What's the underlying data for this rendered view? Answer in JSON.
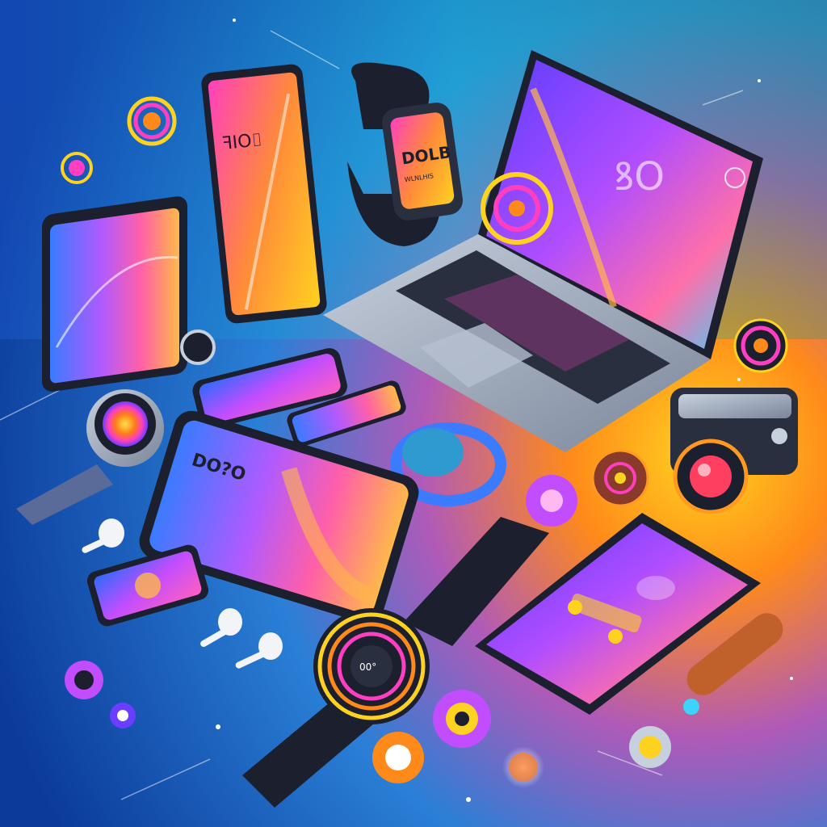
{
  "scene": {
    "palette": {
      "bg_top_left": "#1a5fd0",
      "bg_mid": "#17b6d8",
      "bg_right": "#ff7a18",
      "bg_bottom_left": "#0b3a9a",
      "accent_pink": "#ff3fbf",
      "accent_orange": "#ff9a1f",
      "accent_yellow": "#ffd21f",
      "accent_purple": "#8b3dff",
      "device_dark": "#1b1f2e",
      "device_silver": "#a9b4c6"
    },
    "tall_tablet": {
      "screen_text": "ꟻꓲO⌷"
    },
    "smartwatch_top": {
      "screen_text": "DOLB",
      "screen_subtext": "WLNLHIS"
    },
    "laptop": {
      "screen_text": "ꝸO"
    },
    "bottom_watch": {
      "screen_text": "00°"
    },
    "phone_center": {
      "screen_text": "DO?O"
    }
  }
}
